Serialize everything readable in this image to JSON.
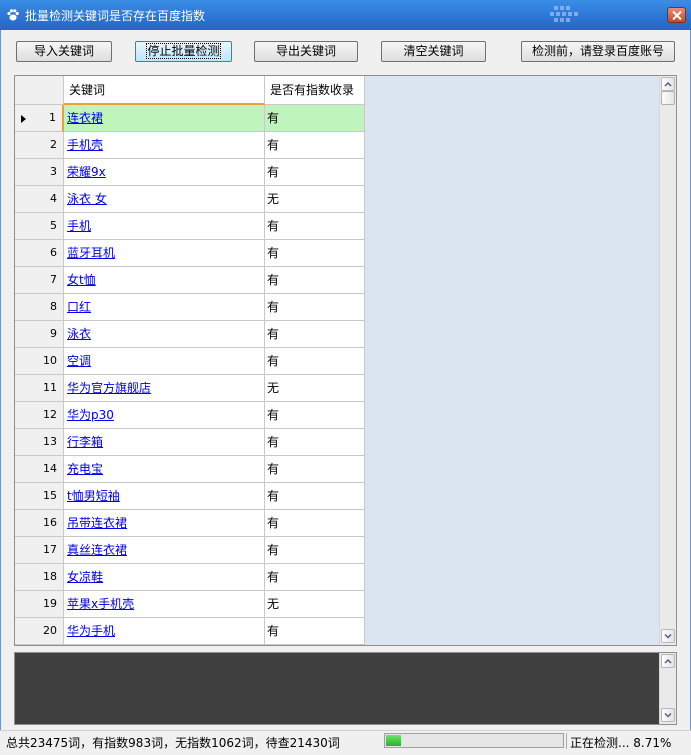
{
  "window": {
    "title": "批量检测关键词是否存在百度指数"
  },
  "toolbar": {
    "import_label": "导入关键词",
    "stop_label": "停止批量检测",
    "export_label": "导出关键词",
    "clear_label": "清空关键词",
    "login_label": "检测前，请登录百度账号"
  },
  "grid": {
    "columns": [
      "关键词",
      "是否有指数收录"
    ],
    "rows": [
      {
        "n": "1",
        "keyword": "连衣裙",
        "indexed": "有"
      },
      {
        "n": "2",
        "keyword": "手机壳",
        "indexed": "有"
      },
      {
        "n": "3",
        "keyword": "荣耀9x",
        "indexed": "有"
      },
      {
        "n": "4",
        "keyword": "泳衣 女",
        "indexed": "无"
      },
      {
        "n": "5",
        "keyword": "手机",
        "indexed": "有"
      },
      {
        "n": "6",
        "keyword": "蓝牙耳机",
        "indexed": "有"
      },
      {
        "n": "7",
        "keyword": "女t恤",
        "indexed": "有"
      },
      {
        "n": "8",
        "keyword": "口红",
        "indexed": "有"
      },
      {
        "n": "9",
        "keyword": "泳衣",
        "indexed": "有"
      },
      {
        "n": "10",
        "keyword": "空调",
        "indexed": "有"
      },
      {
        "n": "11",
        "keyword": "华为官方旗舰店",
        "indexed": "无"
      },
      {
        "n": "12",
        "keyword": "华为p30",
        "indexed": "有"
      },
      {
        "n": "13",
        "keyword": "行李箱",
        "indexed": "有"
      },
      {
        "n": "14",
        "keyword": "充电宝",
        "indexed": "有"
      },
      {
        "n": "15",
        "keyword": "t恤男短袖",
        "indexed": "有"
      },
      {
        "n": "16",
        "keyword": "吊带连衣裙",
        "indexed": "有"
      },
      {
        "n": "17",
        "keyword": "真丝连衣裙",
        "indexed": "有"
      },
      {
        "n": "18",
        "keyword": "女凉鞋",
        "indexed": "有"
      },
      {
        "n": "19",
        "keyword": "苹果x手机壳",
        "indexed": "无"
      },
      {
        "n": "20",
        "keyword": "华为手机",
        "indexed": "有"
      }
    ]
  },
  "status": {
    "summary": "总共23475词，有指数983词，无指数1062词，待查21430词",
    "progress_fraction": 0.0871,
    "state": "正在检测... 8.71%"
  },
  "colors": {
    "titlebar": "#2f7ad8",
    "selected_row": "#bdf5bd",
    "grid_background": "#dbe5f1",
    "log_background": "#404040",
    "progress": "#28b428"
  }
}
